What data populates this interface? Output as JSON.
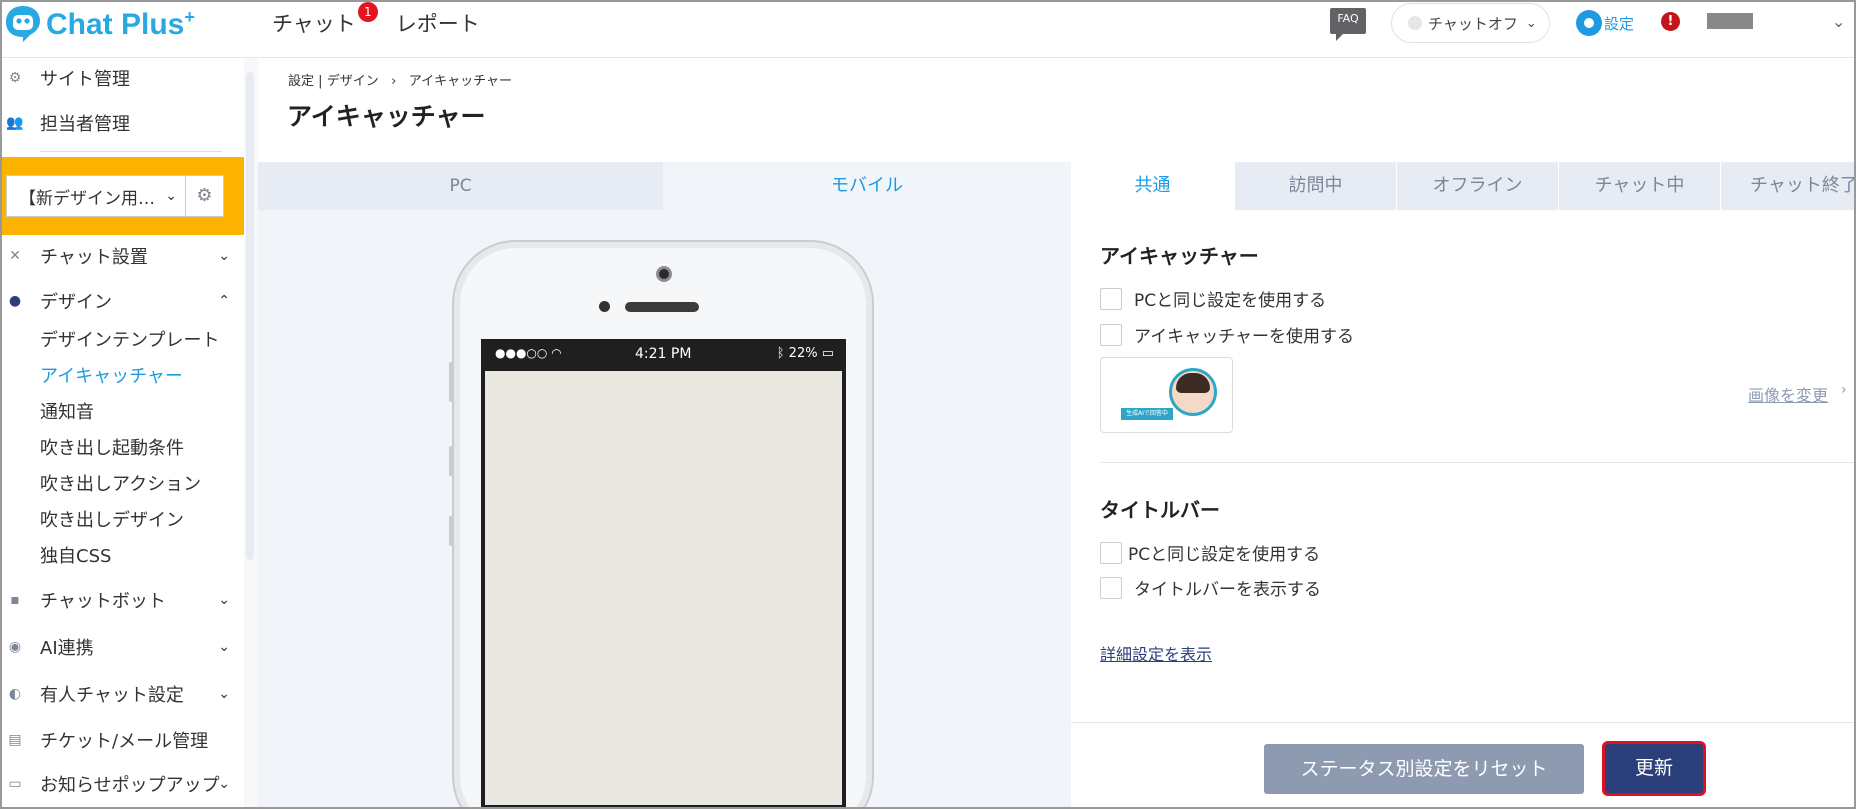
{
  "header": {
    "logo_text": "Chat Plus",
    "logo_plus": "+",
    "nav": [
      {
        "label": "チャット",
        "badge": "1"
      },
      {
        "label": "レポート"
      }
    ],
    "faq_label": "FAQ",
    "status_label": "チャットオフ",
    "settings_label": "設定",
    "alert_label": "!"
  },
  "sidebar": {
    "items": [
      {
        "label": "サイト管理",
        "icon": "gear-icon"
      },
      {
        "label": "担当者管理",
        "icon": "users-icon"
      }
    ],
    "site_selector": {
      "value": "【新デザイン用…"
    },
    "menu": [
      {
        "label": "チャット設置",
        "icon": "wrench-icon",
        "has_chevron": true
      },
      {
        "label": "デザイン",
        "icon": "palette-icon",
        "has_chevron": true,
        "expanded": true
      },
      {
        "label": "チャットボット",
        "icon": "chat-icon",
        "has_chevron": true
      },
      {
        "label": "AI連携",
        "icon": "ai-icon",
        "has_chevron": true
      },
      {
        "label": "有人チャット設定",
        "icon": "headset-icon",
        "has_chevron": true
      },
      {
        "label": "チケット/メール管理",
        "icon": "ticket-icon",
        "has_chevron": false
      },
      {
        "label": "お知らせポップアップ",
        "icon": "popup-icon",
        "has_chevron": true
      }
    ],
    "design_subitems": [
      "デザインテンプレート",
      "アイキャッチャー",
      "通知音",
      "吹き出し起動条件",
      "吹き出しアクション",
      "吹き出しデザイン",
      "独自CSS"
    ],
    "active_subitem": "アイキャッチャー"
  },
  "main": {
    "breadcrumb": {
      "part1": "設定",
      "sep1": "|",
      "part2": "デザイン",
      "sep2": "›",
      "part3": "アイキャッチャー"
    },
    "title": "アイキャッチャー",
    "preview_tabs": [
      {
        "label": "PC",
        "active": false
      },
      {
        "label": "モバイル",
        "active": true
      }
    ],
    "phone_status": {
      "signal": "●●●○○",
      "time": "4:21 PM",
      "battery": "22%"
    },
    "status_tabs": [
      {
        "label": "共通",
        "active": true
      },
      {
        "label": "訪問中",
        "active": false
      },
      {
        "label": "オフライン",
        "active": false
      },
      {
        "label": "チャット中",
        "active": false
      },
      {
        "label": "チャット終了",
        "active": false
      }
    ],
    "eyecatcher_section": {
      "title": "アイキャッチャー",
      "checkbox_pc_same": "PCと同じ設定を使用する",
      "checkbox_use": "アイキャッチャーを使用する",
      "thumbnail_tag": "生成AIで回答中",
      "change_image": "画像を変更"
    },
    "titlebar_section": {
      "title": "タイトルバー",
      "checkbox_pc_same": "PCと同じ設定を使用する",
      "checkbox_show": "タイトルバーを表示する"
    },
    "detail_link": "詳細設定を表示",
    "reset_button": "ステータス別設定をリセット",
    "update_button": "更新"
  },
  "colors": {
    "accent": "#1e9be0",
    "sidebar_highlight": "#fbb300",
    "primary_button": "#2b3f7a",
    "secondary_button": "#8e9ab0",
    "alert": "#c4151b"
  }
}
